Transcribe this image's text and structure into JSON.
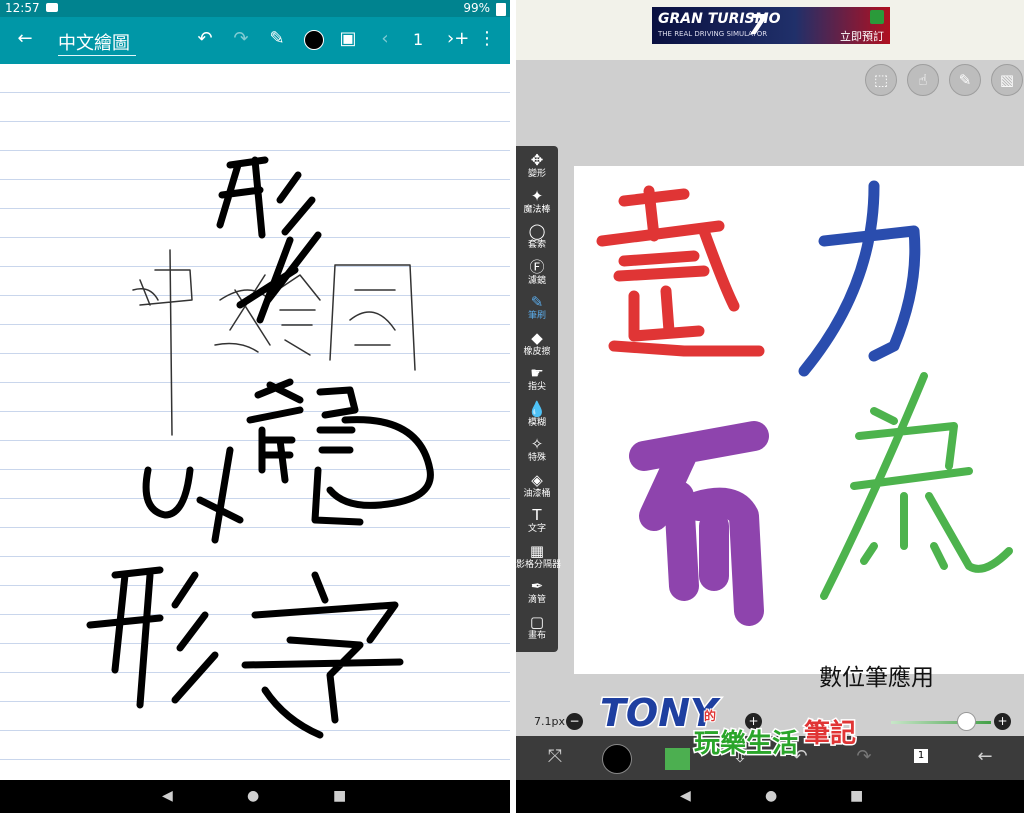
{
  "left_app": {
    "status": {
      "time": "12:57",
      "battery": "99%"
    },
    "toolbar": {
      "title": "中文繪圖",
      "page_number": "1",
      "back_icon": "arrow-left-icon",
      "undo_icon": "undo-icon",
      "redo_icon": "redo-icon",
      "pen_icon": "pen-icon",
      "image_icon": "image-icon",
      "prev_icon": "chevron-left-icon",
      "add_page_icon": "add-page-icon",
      "menu_icon": "more-vert-icon"
    },
    "ink_color": "#000000",
    "canvas_note": ""
  },
  "right_app": {
    "ad": {
      "brand": "GRAN TURISMO",
      "tagline": "THE REAL DRIVING SIMULATOR",
      "number": "7",
      "cta": "立即預訂"
    },
    "tools": [
      {
        "label": "變形",
        "icon": "move-icon"
      },
      {
        "label": "魔法棒",
        "icon": "magic-wand-icon"
      },
      {
        "label": "套索",
        "icon": "lasso-icon"
      },
      {
        "label": "濾鏡",
        "icon": "fx-icon"
      },
      {
        "label": "筆刷",
        "icon": "brush-icon"
      },
      {
        "label": "橡皮擦",
        "icon": "eraser-icon"
      },
      {
        "label": "指尖",
        "icon": "smudge-icon"
      },
      {
        "label": "模糊",
        "icon": "blur-icon"
      },
      {
        "label": "特殊",
        "icon": "special-icon"
      },
      {
        "label": "油漆桶",
        "icon": "fill-icon"
      },
      {
        "label": "文字",
        "icon": "text-icon"
      },
      {
        "label": "影格分隔器",
        "icon": "frame-divider-icon"
      },
      {
        "label": "滴管",
        "icon": "eyedropper-icon"
      },
      {
        "label": "畫布",
        "icon": "canvas-icon"
      }
    ],
    "active_tool": "筆刷",
    "app_label": "數位筆應用",
    "brush": {
      "size_label": "7.1px",
      "opacity_percent": 100
    },
    "current_color": "#4caf50",
    "page_badge": "1",
    "watermark": {
      "top": "TONY",
      "mid": "的",
      "bottom": "玩樂生活筆記"
    },
    "stroke_colors": {
      "red": "#e03535",
      "blue": "#2a4dae",
      "purple": "#8e44ad",
      "green": "#4db34d"
    }
  },
  "nav": {
    "back": "◀",
    "home": "●",
    "recents": "■"
  }
}
